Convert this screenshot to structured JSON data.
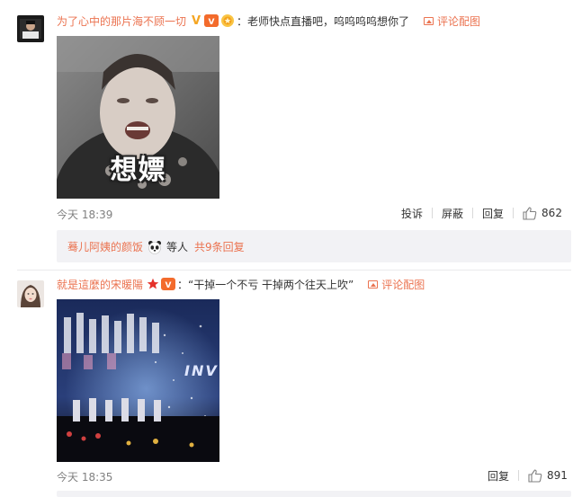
{
  "comments": [
    {
      "username": "为了心中的那片海不顾一切",
      "badge_v": "V",
      "text": "：老师快点直播吧，呜呜呜呜想你了",
      "pic_link": "评论配图",
      "image_caption": "想嫖",
      "time": "今天 18:39",
      "actions": [
        "投诉",
        "屏蔽",
        "回复"
      ],
      "likes": "862",
      "reply_summary": {
        "name": "蓦儿阿姨的颜饭",
        "mid": "等人",
        "link": "共9条回复"
      }
    },
    {
      "username": "就是這麼的宋暖陽",
      "text": "：“干掉一个不亏 干掉两个往天上吹”",
      "pic_link": "评论配图",
      "image_text": "INV",
      "time": "今天 18:35",
      "actions": [
        "回复"
      ],
      "likes": "891"
    }
  ],
  "colors": {
    "accent": "#eb7350",
    "muted": "#808080",
    "reply_bg": "#f2f2f5"
  },
  "icons": [
    "badge-icon",
    "medal-icon",
    "picture-icon",
    "thumbs-up-icon",
    "panda-emoji-icon",
    "star-badge-icon"
  ]
}
